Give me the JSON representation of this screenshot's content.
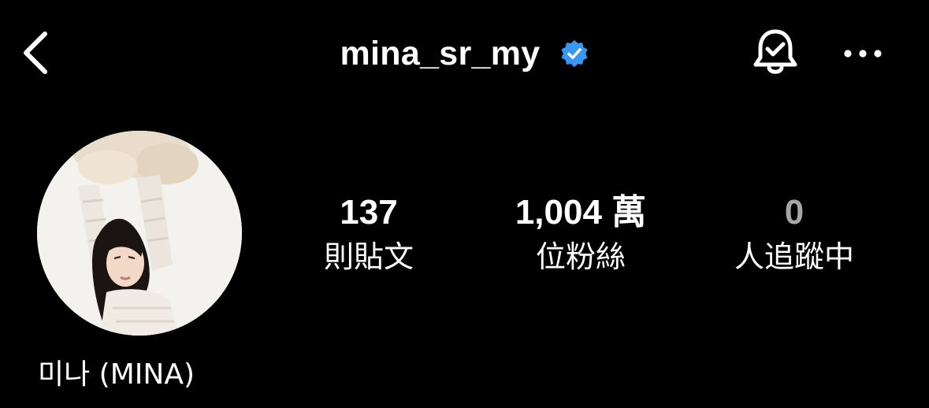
{
  "header": {
    "username": "mina_sr_my",
    "verified_color": "#3897f0",
    "icons": [
      "chevron-left-icon",
      "verified-badge-icon",
      "bell-check-icon",
      "more-horizontal-icon"
    ]
  },
  "profile": {
    "display_name": "미나 (MINA)"
  },
  "stats": {
    "posts": {
      "count": "137",
      "label": "則貼文"
    },
    "followers": {
      "count": "1,004 萬",
      "label": "位粉絲"
    },
    "following": {
      "count": "0",
      "label": "人追蹤中"
    }
  }
}
